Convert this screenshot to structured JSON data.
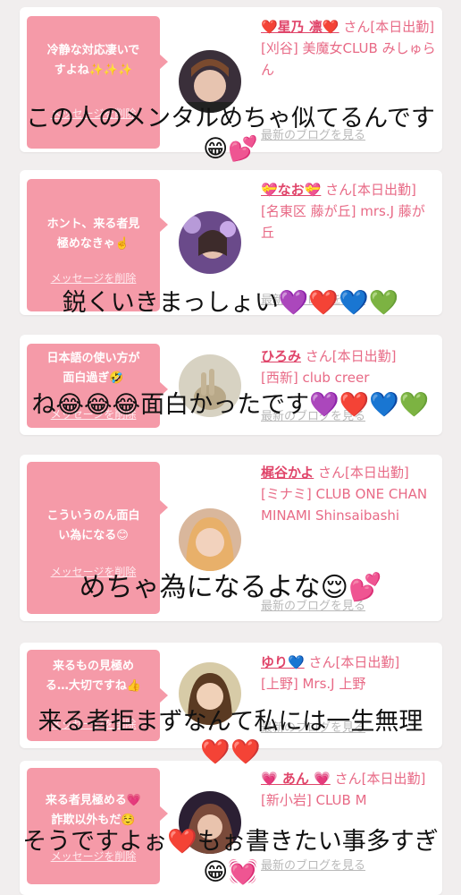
{
  "cards": [
    {
      "message": "冷静な対応凄いで\nすよね✨✨✨",
      "delete_label": "メッセージを削除",
      "name": "❤️星乃 凛❤️",
      "honorific": "さん[本日出勤]",
      "shop": "[刈谷] 美魔女CLUB みしゅらん",
      "blog": "最新のブログを見る",
      "avatar": "avatar-photo-1"
    },
    {
      "message": "ホント、来る者見\n極めなきゃ☝️",
      "delete_label": "メッセージを削除",
      "name": "💝なお💝",
      "honorific": "さん[本日出勤]",
      "shop": "[名東区 藤が丘] mrs.J 藤が丘",
      "blog": "最新のブログを見る",
      "avatar": "avatar-photo-2"
    },
    {
      "message": "日本語の使い方が\n面白過ぎ🤣",
      "delete_label": "メッセージを削除",
      "name": "ひろみ",
      "honorific": "さん[本日出勤]",
      "shop": "[西新] club creer",
      "blog": "最新のブログを見る",
      "avatar": "avatar-photo-3"
    },
    {
      "message": "こういうのん面白\nい為になる😊",
      "delete_label": "メッセージを削除",
      "name": "梶谷かよ",
      "honorific": "さん[本日出勤]",
      "shop": "[ミナミ] CLUB ONE CHAN MINAMI Shinsaibashi",
      "blog": "最新のブログを見る",
      "avatar": "avatar-photo-4"
    },
    {
      "message": "来るもの見極め\nる…大切ですね👍",
      "delete_label": "メッセージを削除",
      "name": "ゆり💙",
      "honorific": "さん[本日出勤]",
      "shop": "[上野] Mrs.J 上野",
      "blog": "最新のブログを見る",
      "avatar": "avatar-photo-5"
    },
    {
      "message": "来る者見極める💗\n詐欺以外もだ☺️",
      "delete_label": "メッセージを削除",
      "name": "💗 あん 💗",
      "honorific": "さん[本日出勤]",
      "shop": "[新小岩] CLUB M",
      "blog": "最新のブログを見る",
      "avatar": "avatar-photo-6"
    }
  ],
  "overlays": [
    "この人のメンタルめちゃ似てるんです\n😁💕",
    "鋭くいきまっしょい💜❤️💙💚",
    "ね😂😂😂面白かったです💜❤️💙💚",
    "めちゃ為になるよな😌💕",
    "来る者拒まずなんて私には一生無理\n❤️❤️",
    "そうですよぉ❤️もぉ書きたい事多すぎ\n😁💓"
  ],
  "colors": {
    "bubble": "#f59aa8",
    "name": "#e0456a",
    "text": "#e86a86",
    "background": "#f1eeee"
  }
}
